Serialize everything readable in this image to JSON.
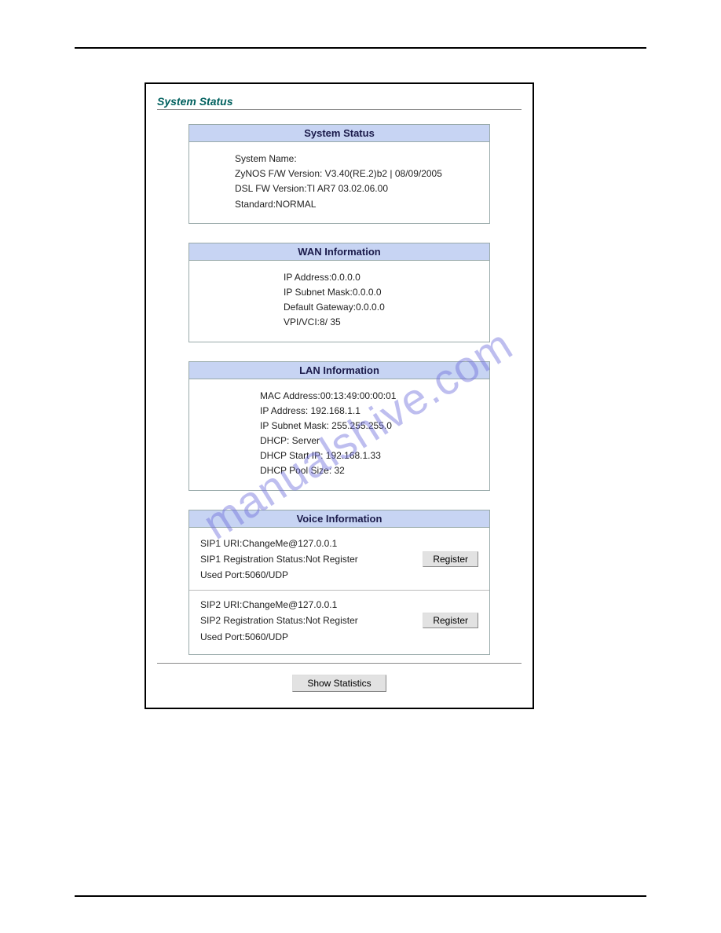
{
  "page": {
    "title": "System Status",
    "watermark": "manualshive.com"
  },
  "systemStatus": {
    "header": "System Status",
    "systemNameLabel": "System Name:",
    "zynosVersion": "ZyNOS F/W Version: V3.40(RE.2)b2 | 08/09/2005",
    "dslVersion": "DSL FW Version:TI AR7 03.02.06.00",
    "standard": "Standard:NORMAL"
  },
  "wan": {
    "header": "WAN Information",
    "ip": "IP Address:0.0.0.0",
    "subnet": "IP Subnet Mask:0.0.0.0",
    "gateway": "Default Gateway:0.0.0.0",
    "vpi": "VPI/VCI:8/ 35"
  },
  "lan": {
    "header": "LAN Information",
    "mac": "MAC Address:00:13:49:00:00:01",
    "ip": "IP Address: 192.168.1.1",
    "subnet": "IP Subnet Mask: 255.255.255.0",
    "dhcp": "DHCP: Server",
    "dhcpStart": "DHCP Start IP: 192.168.1.33",
    "dhcpPool": "DHCP Pool Size: 32"
  },
  "voice": {
    "header": "Voice Information",
    "sip1Uri": "SIP1 URI:ChangeMe@127.0.0.1",
    "sip1Status": "SIP1 Registration Status:Not Register",
    "sip1Port": "Used Port:5060/UDP",
    "sip2Uri": "SIP2 URI:ChangeMe@127.0.0.1",
    "sip2Status": "SIP2 Registration Status:Not Register",
    "sip2Port": "Used Port:5060/UDP",
    "registerLabel": "Register"
  },
  "footer": {
    "showStats": "Show Statistics"
  }
}
